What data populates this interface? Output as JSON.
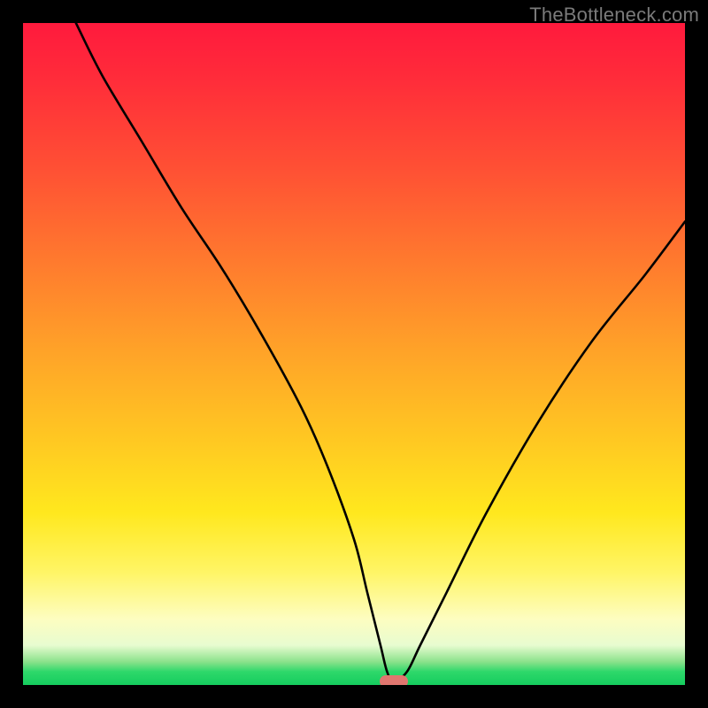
{
  "watermark": "TheBottleneck.com",
  "chart_data": {
    "type": "line",
    "title": "",
    "xlabel": "",
    "ylabel": "",
    "xlim": [
      0,
      100
    ],
    "ylim": [
      0,
      100
    ],
    "grid": false,
    "series": [
      {
        "name": "bottleneck-curve",
        "x": [
          8,
          12,
          18,
          24,
          30,
          36,
          42,
          46,
          50,
          52,
          54,
          55,
          56,
          58,
          60,
          64,
          70,
          78,
          86,
          94,
          100
        ],
        "values": [
          100,
          92,
          82,
          72,
          63,
          53,
          42,
          33,
          22,
          14,
          6,
          2,
          0.5,
          2,
          6,
          14,
          26,
          40,
          52,
          62,
          70
        ]
      }
    ],
    "annotations": [
      {
        "name": "optimal-marker",
        "x": 56,
        "y": 0.5,
        "shape": "pill",
        "color": "#e0766f"
      }
    ],
    "background": {
      "type": "vertical-gradient",
      "stops": [
        {
          "pos": 0,
          "color": "#ff1a3d"
        },
        {
          "pos": 0.5,
          "color": "#ffa428"
        },
        {
          "pos": 0.75,
          "color": "#ffe81e"
        },
        {
          "pos": 0.93,
          "color": "#fdfdc0"
        },
        {
          "pos": 1.0,
          "color": "#15cc5e"
        }
      ]
    }
  }
}
